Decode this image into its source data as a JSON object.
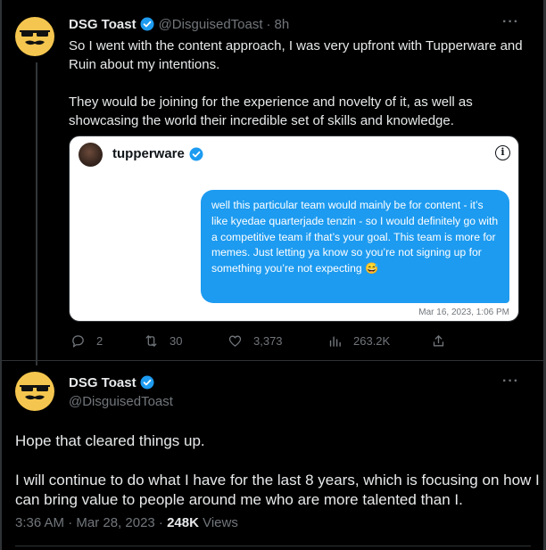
{
  "colors": {
    "background": "#000000",
    "text": "#e7e9ea",
    "muted": "#71767b",
    "accent": "#1d9bf0",
    "avatar_yellow": "#f5c64f"
  },
  "tweet1": {
    "name": "DSG Toast",
    "handle": "@DisguisedToast",
    "dot": "·",
    "time": "8h",
    "more": "···",
    "paragraphs": [
      "So I went with the content approach, I was very upfront with Tupperware and Ruin about my intentions.",
      "They would be joining for the experience and novelty of it, as well as showcasing the world their incredible set of skills and knowledge."
    ],
    "card": {
      "username": "tupperware",
      "info": "i",
      "message": "well this particular team would mainly be for content - it’s like kyedae quarterjade tenzin - so I would definitely go with a competitive team if that’s your goal. This team is more for memes. Just letting ya know so you’re not signing up for something you’re not expecting 😅",
      "timestamp": "Mar 16, 2023, 1:06 PM"
    },
    "actions": {
      "replies": "2",
      "retweets": "30",
      "likes": "3,373",
      "views": "263.2K"
    }
  },
  "tweet2": {
    "name": "DSG Toast",
    "handle": "@DisguisedToast",
    "more": "···",
    "paragraphs": [
      "Hope that cleared things up.",
      "I will continue to do what I have for the last 8 years, which is focusing on how I can bring value to people around me who are more talented than I."
    ],
    "time": "3:36 AM · Mar 28, 2023 · ",
    "views_count": "248K",
    "views_label": " Views"
  }
}
